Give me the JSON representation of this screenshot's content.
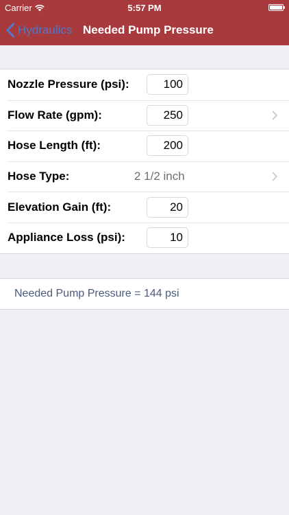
{
  "status_bar": {
    "carrier": "Carrier",
    "time": "5:57 PM"
  },
  "nav": {
    "back_label": "Hydraulics",
    "title": "Needed Pump Pressure"
  },
  "colors": {
    "header_bg": "#a83a3d",
    "back_link": "#4f78c8",
    "result_text": "#4a5a7c",
    "page_bg": "#efeff4"
  },
  "form": {
    "nozzle_pressure": {
      "label": "Nozzle Pressure (psi):",
      "value": "100"
    },
    "flow_rate": {
      "label": "Flow Rate (gpm):",
      "value": "250"
    },
    "hose_length": {
      "label": "Hose Length (ft):",
      "value": "200"
    },
    "hose_type": {
      "label": "Hose Type:",
      "value": "2 1/2 inch"
    },
    "elevation_gain": {
      "label": "Elevation Gain (ft):",
      "value": "20"
    },
    "appliance_loss": {
      "label": "Appliance Loss (psi):",
      "value": "10"
    }
  },
  "result": {
    "text": "Needed Pump Pressure = 144 psi"
  }
}
